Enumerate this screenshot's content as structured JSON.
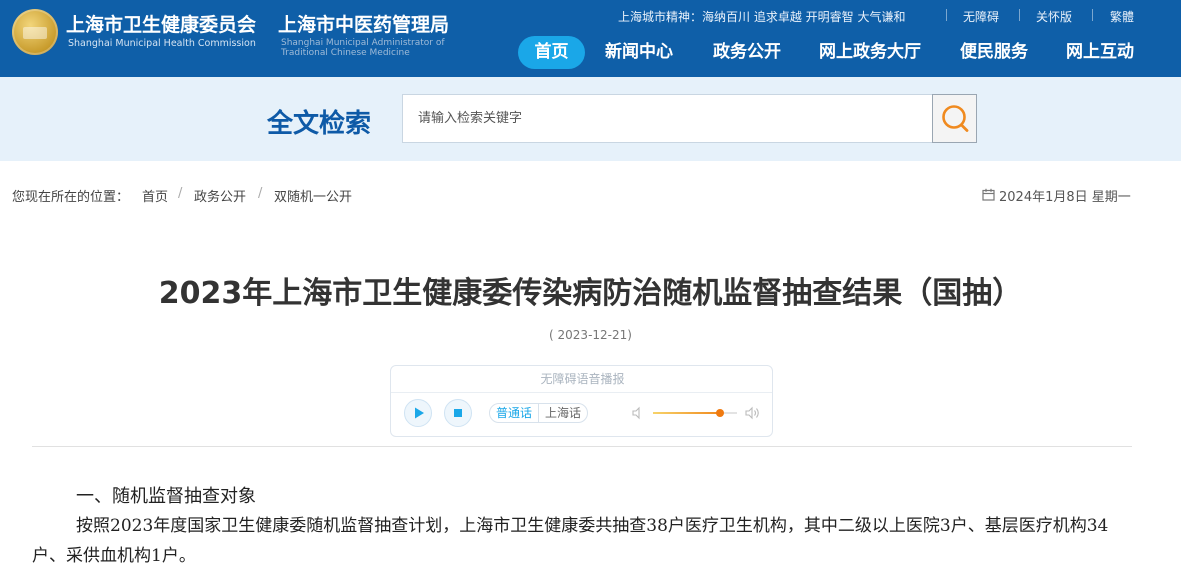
{
  "header": {
    "org_cn_1": "上海市卫生健康委员会",
    "org_en_1": "Shanghai Municipal Health Commission",
    "org_cn_2": "上海市中医药管理局",
    "org_en_2": "Shanghai Municipal Administrator of Traditional Chinese Medicine",
    "spirit": "上海城市精神：海纳百川 追求卓越 开明睿智 大气谦和",
    "top_links": [
      "无障碍",
      "关怀版",
      "繁體"
    ],
    "nav": [
      "首页",
      "新闻中心",
      "政务公开",
      "网上政务大厅",
      "便民服务",
      "网上互动"
    ],
    "active_nav": "首页",
    "colors": {
      "header_bg": "#0f5fa8",
      "active_nav_bg": "#1aa7e8",
      "search_band": "#e6f1fa",
      "accent_orange": "#f08a1f"
    }
  },
  "search": {
    "title": "全文检索",
    "placeholder": "请输入检索关键字",
    "icon": "search-icon"
  },
  "breadcrumb": {
    "prefix": "您现在所在的位置：",
    "items": [
      "首页",
      "政务公开",
      "双随机一公开"
    ]
  },
  "date": {
    "icon": "calendar-icon",
    "text": "2024年1月8日 星期一"
  },
  "article": {
    "title": "2023年上海市卫生健康委传染病防治随机监督抽查结果（国抽）",
    "published": "( 2023-12-21)",
    "section_heading": "一、随机监督抽查对象",
    "paragraph": "按照2023年度国家卫生健康委随机监督抽查计划，上海市卫生健康委共抽查38户医疗卫生机构，其中二级以上医院3户、基层医疗机构34户、采供血机构1户。"
  },
  "player": {
    "label": "无障碍语音播报",
    "lang_options": [
      "普通话",
      "上海话"
    ],
    "selected_lang": "普通话",
    "volume": 0.8
  }
}
